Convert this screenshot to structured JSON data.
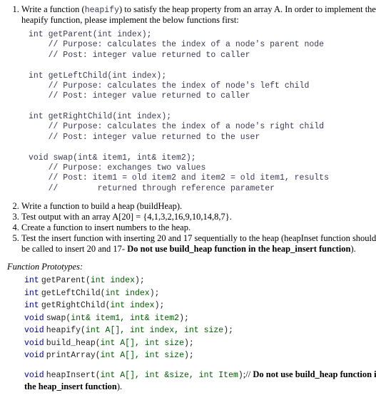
{
  "q1": {
    "text_a": "Write a function (",
    "fn": "heapify",
    "text_b": ") to satisfy the heap property from an array A. In order to implement the heapify function, please implement the below functions first:",
    "code": "int getParent(int index);\n    // Purpose: calculates the index of a node's parent node\n    // Post: integer value returned to caller\n\nint getLeftChild(int index);\n    // Purpose: calculates the index of node's left child\n    // Post: integer value returned to caller\n\nint getRightChild(int index);\n    // Purpose: calculates the index of a node's right child\n    // Post: integer value returned to the user\n\nvoid swap(int& item1, int& item2);\n    // Purpose: exchanges two values\n    // Post: item1 = old item2 and item2 = old item1, results\n    //        returned through reference parameter"
  },
  "q2": "Write a function to build a heap (buildHeap).",
  "q3": "Test output with an array A[20] = {4,1,3,2,16,9,10,14,8,7}.",
  "q4": "Create a function to insert numbers to the heap.",
  "q5": {
    "a": "Test the insert function with inserting 20 and 17 sequentially to the heap (heapInset function should be called to insert 20 and 17- ",
    "b": "Do not use build_heap function in the heap_insert function",
    "c": ")."
  },
  "proto_head": "Function Prototypes:",
  "protos": {
    "p1": {
      "ret": "int",
      "name": "getParent",
      "args": "int index"
    },
    "p2": {
      "ret": "int",
      "name": "getLeftChild",
      "args": "int index"
    },
    "p3": {
      "ret": "int",
      "name": "getRightChild",
      "args": "int index"
    },
    "p4": {
      "ret": "void",
      "name": "swap",
      "args": "int& item1, int& item2"
    },
    "p5": {
      "ret": "void",
      "name": "heapify",
      "args": "int A[], int index, int size"
    },
    "p6": {
      "ret": "void",
      "name": "build_heap",
      "args": "int A[], int size"
    },
    "p7": {
      "ret": "void",
      "name": "printArray",
      "args": "int A[], int size"
    },
    "p8": {
      "ret": "void",
      "name": "heapInsert",
      "args": "int A[], int &size, int Item",
      "after_a": ";// ",
      "after_b": "Do not use build_heap function in the heap_insert function",
      "after_c": ")."
    }
  }
}
